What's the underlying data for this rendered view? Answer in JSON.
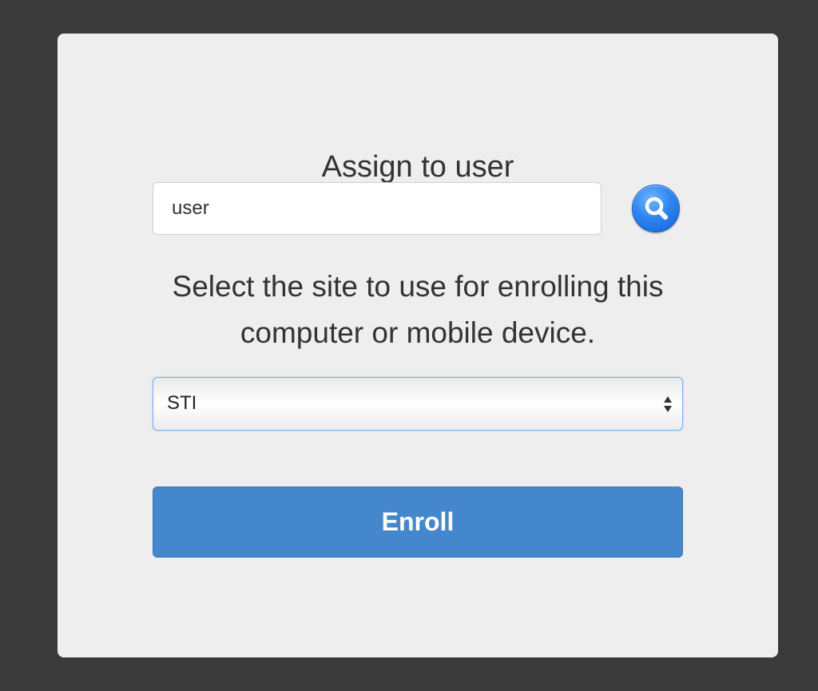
{
  "dialog": {
    "title": "Assign to user",
    "user_input": {
      "value": "user",
      "placeholder": ""
    },
    "search_button": {
      "icon": "search-icon",
      "color": "#2f86f0"
    },
    "instructions": {
      "line1": "Select the site to use for enrolling this",
      "line2": "computer or mobile device."
    },
    "site_select": {
      "selected": "STI",
      "icon": "select-arrows-icon"
    },
    "enroll_button": {
      "label": "Enroll",
      "color": "#4587cc"
    }
  },
  "colors": {
    "background": "#3a3a3a",
    "card": "#eeeeee",
    "text": "#333333",
    "accent": "#4587cc"
  }
}
